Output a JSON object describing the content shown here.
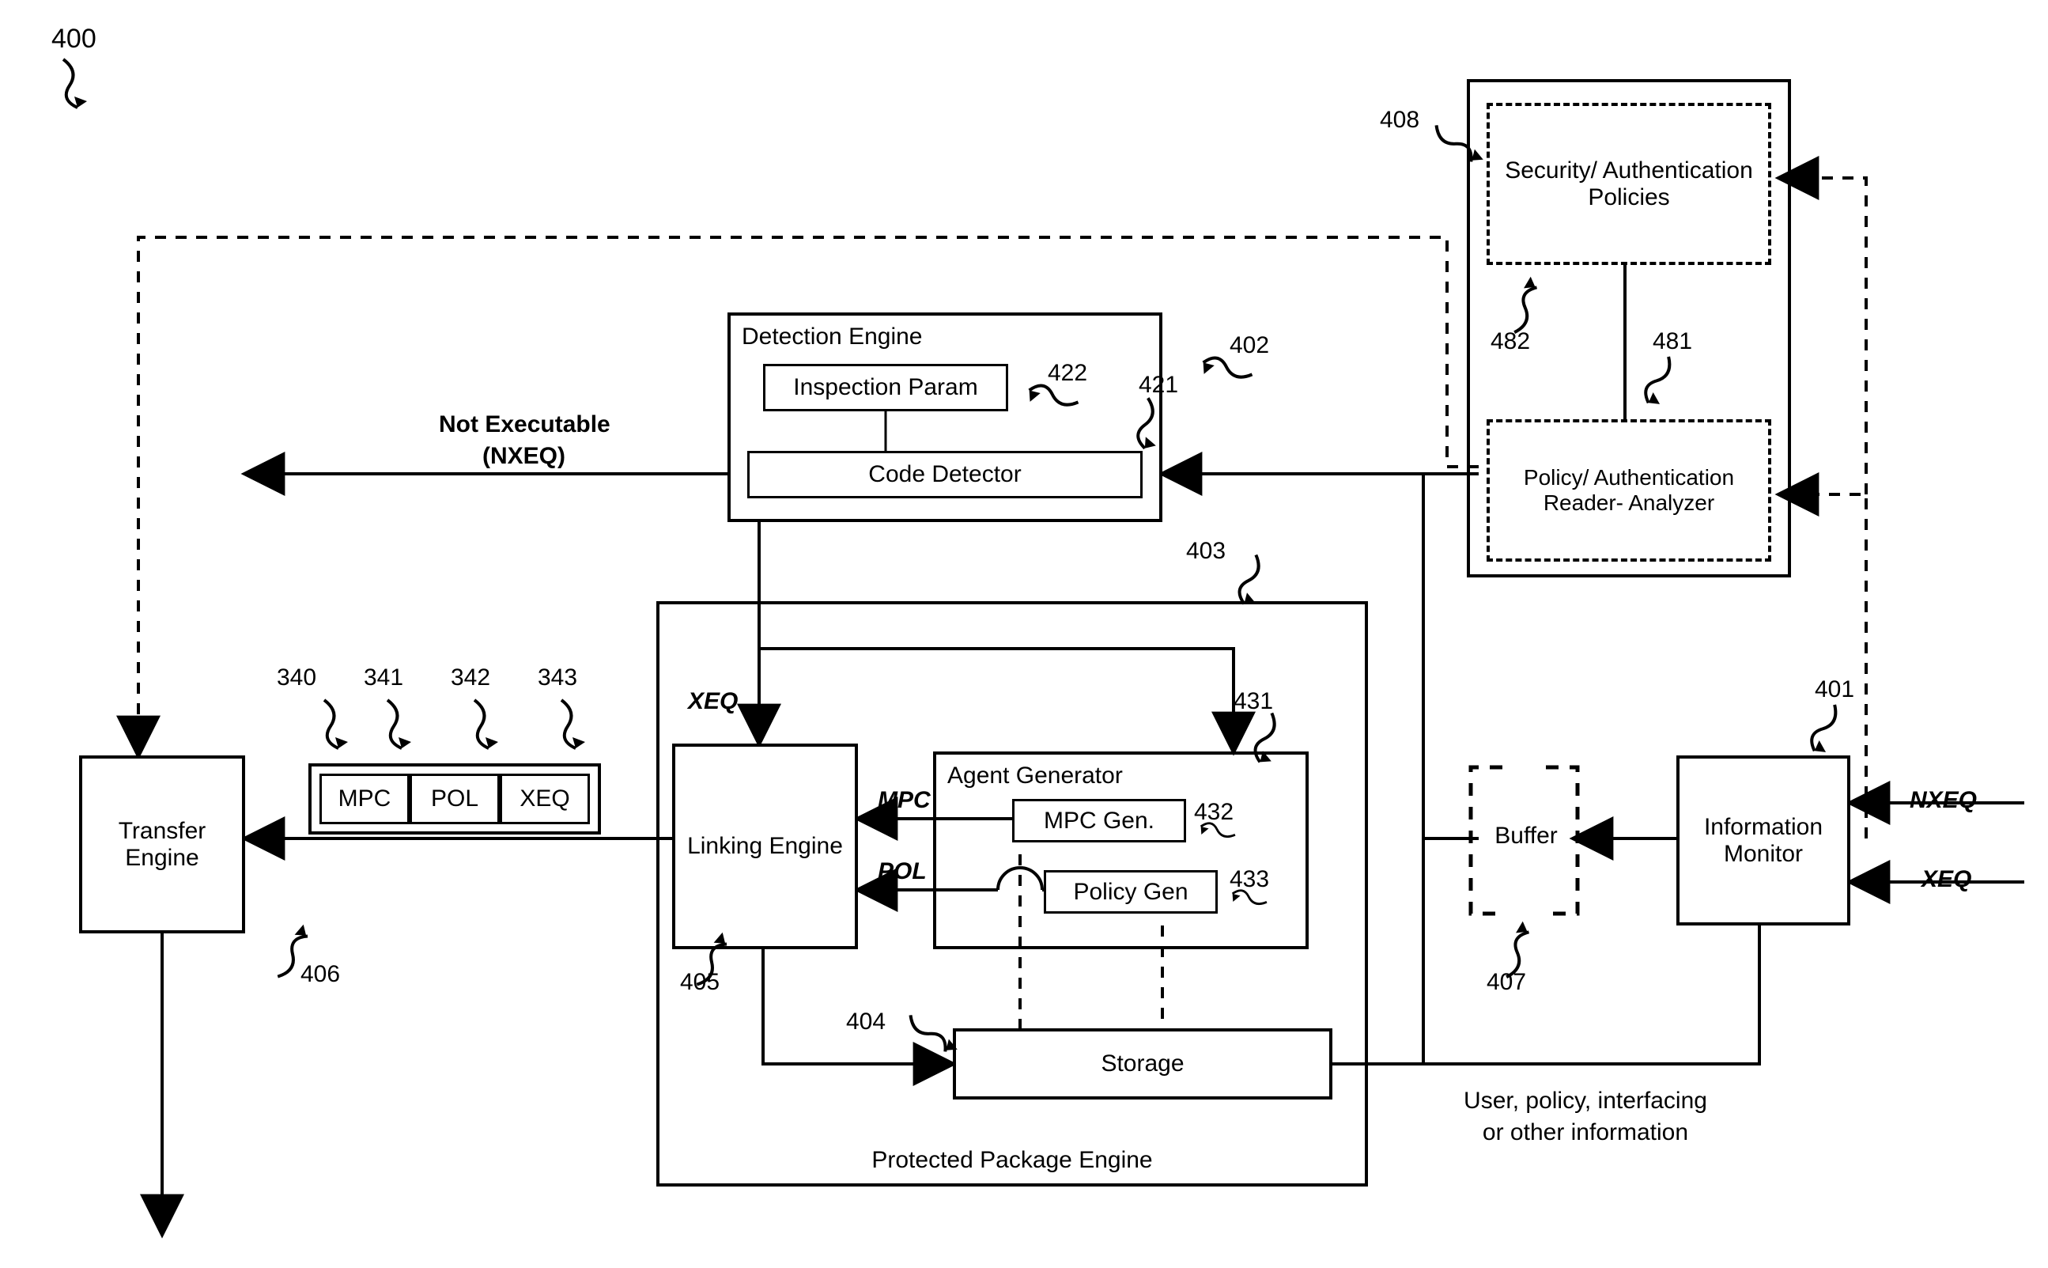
{
  "figure_ref": "400",
  "edge_text": {
    "not_executable_line1": "Not Executable",
    "not_executable_line2": "(NXEQ)",
    "xeq_into_linking": "XEQ",
    "mpc_edge": "MPC",
    "pol_edge": "POL",
    "nxeq_in": "NXEQ",
    "xeq_in": "XEQ",
    "user_note_line1": "User, policy, interfacing",
    "user_note_line2": "or other information"
  },
  "blocks": {
    "transfer_engine": "Transfer\nEngine",
    "detection_engine_title": "Detection Engine",
    "inspection_param": "Inspection Param",
    "code_detector": "Code Detector",
    "protected_pkg_title": "Protected Package Engine",
    "linking_engine": "Linking\nEngine",
    "agent_gen_title": "Agent Generator",
    "mpc_gen": "MPC Gen.",
    "policy_gen": "Policy Gen",
    "storage": "Storage",
    "buffer": "Buffer",
    "info_monitor": "Information\nMonitor",
    "sec_auth_policies": "Security/\nAuthentication\nPolicies",
    "policy_reader_analyzer": "Policy/\nAuthentication\nReader-\nAnalyzer",
    "mpc": "MPC",
    "pol": "POL",
    "xeq": "XEQ"
  },
  "refs": {
    "r400": "400",
    "r340": "340",
    "r341": "341",
    "r342": "342",
    "r343": "343",
    "r401": "401",
    "r402": "402",
    "r403": "403",
    "r404": "404",
    "r405": "405",
    "r406": "406",
    "r407": "407",
    "r408": "408",
    "r421": "421",
    "r422": "422",
    "r431": "431",
    "r432": "432",
    "r433": "433",
    "r481": "481",
    "r482": "482"
  }
}
